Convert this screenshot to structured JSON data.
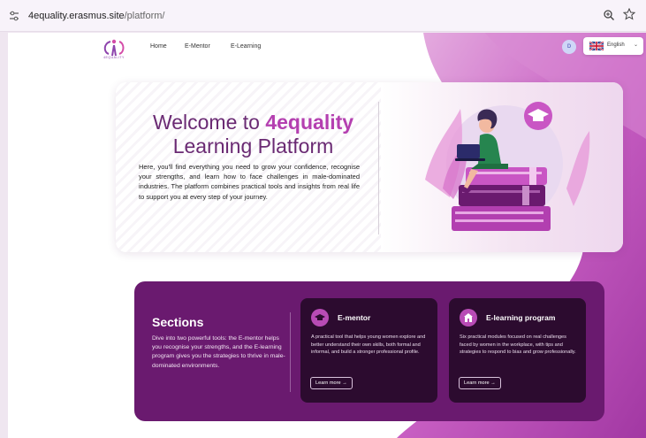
{
  "browser": {
    "url_domain": "4equality.erasmus.site",
    "url_path": "/platform/"
  },
  "nav": {
    "logo_text": "4EQUALITY",
    "links": [
      "Home",
      "E-Mentor",
      "E-Learning"
    ],
    "avatar_initial": "D",
    "language": "English"
  },
  "hero": {
    "title_prefix": "Welcome to",
    "title_accent": "4equality",
    "title_suffix": "Learning Platform",
    "description": "Here, you'll find everything you need to grow your confidence, recognise your strengths, and learn how to face challenges in male-dominated industries. The platform combines practical tools and insights from real life to support you at every step of your journey."
  },
  "sections": {
    "title": "Sections",
    "description": "Dive into two powerful tools: the E-mentor helps you recognise your strengths, and the E-learning program gives you the strategies to thrive in male-dominated environments.",
    "cards": [
      {
        "title": "E-mentor",
        "icon": "graduation-cap-icon",
        "description": "A practical tool that helps young women explore and better understand their own skills, both formal and informal, and build a stronger professional profile.",
        "button": "Learn more →"
      },
      {
        "title": "E-learning program",
        "icon": "school-building-icon",
        "description": "Six practical modules focused on real challenges faced by women in the workplace, with tips and strategies to respond to bias and grow professionally.",
        "button": "Learn more →"
      }
    ]
  },
  "colors": {
    "brand_purple": "#6a1a6f",
    "accent_magenta": "#b43fb0",
    "card_dark": "#2c0b2f",
    "page_background": "#efe6f0"
  }
}
